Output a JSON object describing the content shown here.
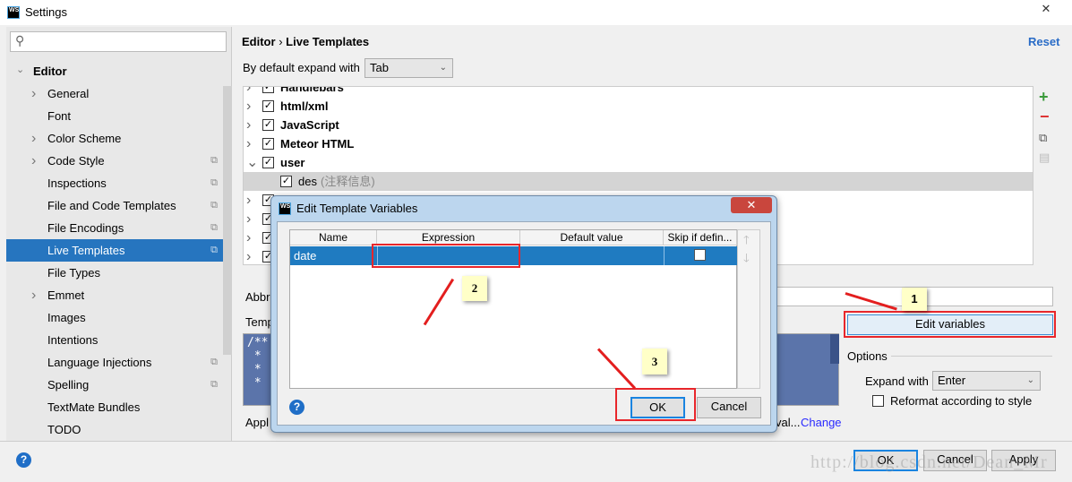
{
  "window": {
    "title": "Settings",
    "close": "✕"
  },
  "sidebar": {
    "search_placeholder": "",
    "section": "Editor",
    "items": [
      {
        "label": "General",
        "chevron": true,
        "copy": false
      },
      {
        "label": "Font",
        "chevron": false,
        "copy": false
      },
      {
        "label": "Color Scheme",
        "chevron": true,
        "copy": false
      },
      {
        "label": "Code Style",
        "chevron": true,
        "copy": true
      },
      {
        "label": "Inspections",
        "chevron": false,
        "copy": true
      },
      {
        "label": "File and Code Templates",
        "chevron": false,
        "copy": true
      },
      {
        "label": "File Encodings",
        "chevron": false,
        "copy": true
      },
      {
        "label": "Live Templates",
        "chevron": false,
        "copy": true,
        "selected": true
      },
      {
        "label": "File Types",
        "chevron": false,
        "copy": false
      },
      {
        "label": "Emmet",
        "chevron": true,
        "copy": false
      },
      {
        "label": "Images",
        "chevron": false,
        "copy": false
      },
      {
        "label": "Intentions",
        "chevron": false,
        "copy": false
      },
      {
        "label": "Language Injections",
        "chevron": false,
        "copy": true
      },
      {
        "label": "Spelling",
        "chevron": false,
        "copy": true
      },
      {
        "label": "TextMate Bundles",
        "chevron": false,
        "copy": false
      },
      {
        "label": "TODO",
        "chevron": false,
        "copy": false
      }
    ]
  },
  "main": {
    "breadcrumb_parent": "Editor",
    "breadcrumb_sep": "›",
    "breadcrumb_current": "Live Templates",
    "reset": "Reset",
    "expand_label": "By default expand with",
    "expand_value": "Tab",
    "templates": [
      {
        "label": "Handlebars",
        "group": true,
        "expanded": false
      },
      {
        "label": "html/xml",
        "group": true,
        "expanded": false
      },
      {
        "label": "JavaScript",
        "group": true,
        "expanded": false
      },
      {
        "label": "Meteor HTML",
        "group": true,
        "expanded": false
      },
      {
        "label": "user",
        "group": true,
        "expanded": true
      },
      {
        "label": "des",
        "desc": "(注释信息)",
        "group": false,
        "selected": true
      },
      {
        "label": "",
        "group": true
      },
      {
        "label": "",
        "group": true
      },
      {
        "label": "",
        "group": true
      },
      {
        "label": "",
        "group": true
      }
    ],
    "abbr_label": "Abbr",
    "template_label": "Temp",
    "template_lines": [
      "/**",
      " *",
      " *",
      " *"
    ],
    "applicable_prefix": "Appl",
    "applicable_suffix": "val...",
    "change_link": "Change",
    "edit_variables": "Edit variables",
    "options_label": "Options",
    "expand_with_label": "Expand with",
    "expand_with_value": "Enter",
    "reformat_label": "Reformat according to style",
    "reformat_checked": false
  },
  "footer": {
    "ok": "OK",
    "cancel": "Cancel",
    "apply": "Apply",
    "watermark": "http://blog.csdn.net/Dean_Mr"
  },
  "dialog": {
    "title": "Edit Template Variables",
    "columns": [
      "Name",
      "Expression",
      "Default value",
      "Skip if defin..."
    ],
    "rows": [
      {
        "name": "date",
        "expression": "",
        "default": "",
        "skip": false
      }
    ],
    "ok": "OK",
    "cancel": "Cancel"
  },
  "annotations": [
    "1",
    "2",
    "3"
  ],
  "colors": {
    "selection": "#2675bf",
    "annotation": "#e8262b",
    "link": "#2a2aff"
  }
}
